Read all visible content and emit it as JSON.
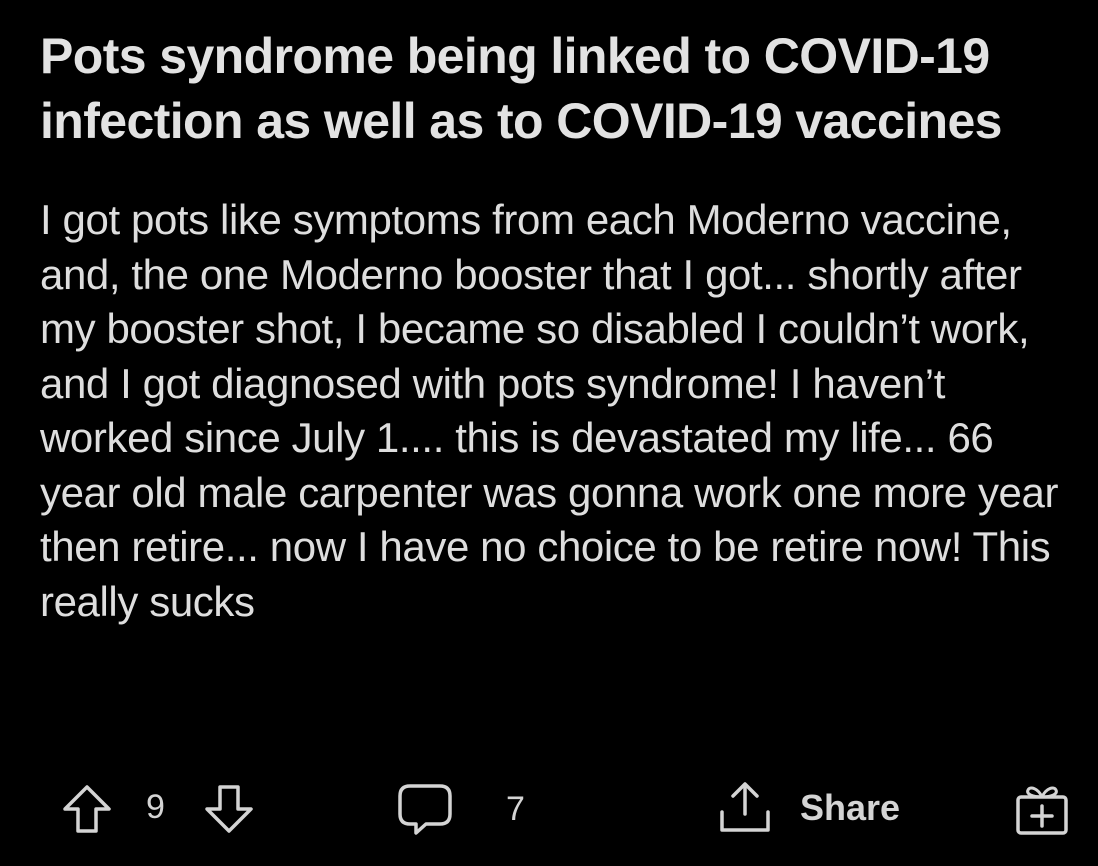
{
  "post": {
    "title": "Pots syndrome being linked to COVID-19 infection as well as to COVID-19 vaccines",
    "body": "I got pots like symptoms from each Moderno vaccine, and, the one Moderno booster that I got... shortly after my booster shot, I became so disabled I couldn’t work, and I got diagnosed with pots syndrome! I haven’t worked since July 1.... this is devastated my life... 66 year old male carpenter was gonna work one more year then retire... now I have no choice to be retire now! This really sucks"
  },
  "actions": {
    "vote_count": "9",
    "comment_count": "7",
    "share_label": "Share",
    "icons": {
      "upvote": "arrow-up-outline-icon",
      "downvote": "arrow-down-outline-icon",
      "comment": "speech-bubble-icon",
      "share": "share-upload-icon",
      "award": "gift-box-icon"
    }
  },
  "colors": {
    "background": "#000000",
    "text": "#dedede",
    "icon": "#d4d4d4"
  }
}
